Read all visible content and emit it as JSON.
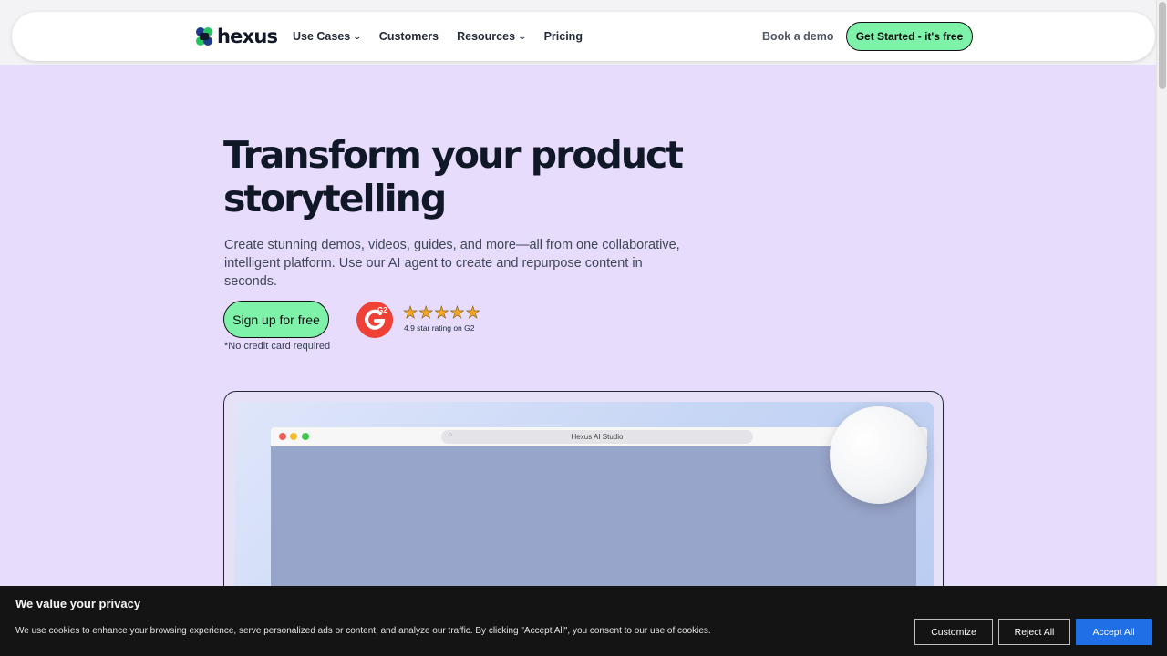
{
  "nav": {
    "logo_text": "hexus",
    "links": [
      {
        "label": "Use Cases",
        "has_dropdown": true
      },
      {
        "label": "Customers",
        "has_dropdown": false
      },
      {
        "label": "Resources",
        "has_dropdown": true
      },
      {
        "label": "Pricing",
        "has_dropdown": false
      }
    ],
    "book_demo_label": "Book a demo",
    "get_started_label": "Get Started - it's free"
  },
  "hero": {
    "title_line1": "Transform your product",
    "title_line2": "storytelling",
    "subtitle_line1": "Create stunning demos, videos, guides, and more—all from one collaborative,",
    "subtitle_line2": "intelligent platform. Use our AI agent to create and repurpose content in seconds.",
    "signup_label": "Sign up for free",
    "no_credit_card": "*No credit card required",
    "rating": {
      "badge": "G2",
      "stars": 5,
      "text": "4.9 star rating on G2"
    }
  },
  "preview": {
    "browser_url": "Hexus AI Studio"
  },
  "cookie_banner": {
    "title": "We value your privacy",
    "text": "We use cookies to enhance your browsing experience, serve personalized ads or content, and analyze our traffic. By clicking \"Accept All\", you consent to our use of cookies.",
    "customize_label": "Customize",
    "reject_label": "Reject All",
    "accept_label": "Accept All"
  },
  "colors": {
    "hero_background": "#e7dcfc",
    "cta_green": "#7ef2a8",
    "accept_blue": "#1f6fe6",
    "banner_background": "#141414"
  }
}
